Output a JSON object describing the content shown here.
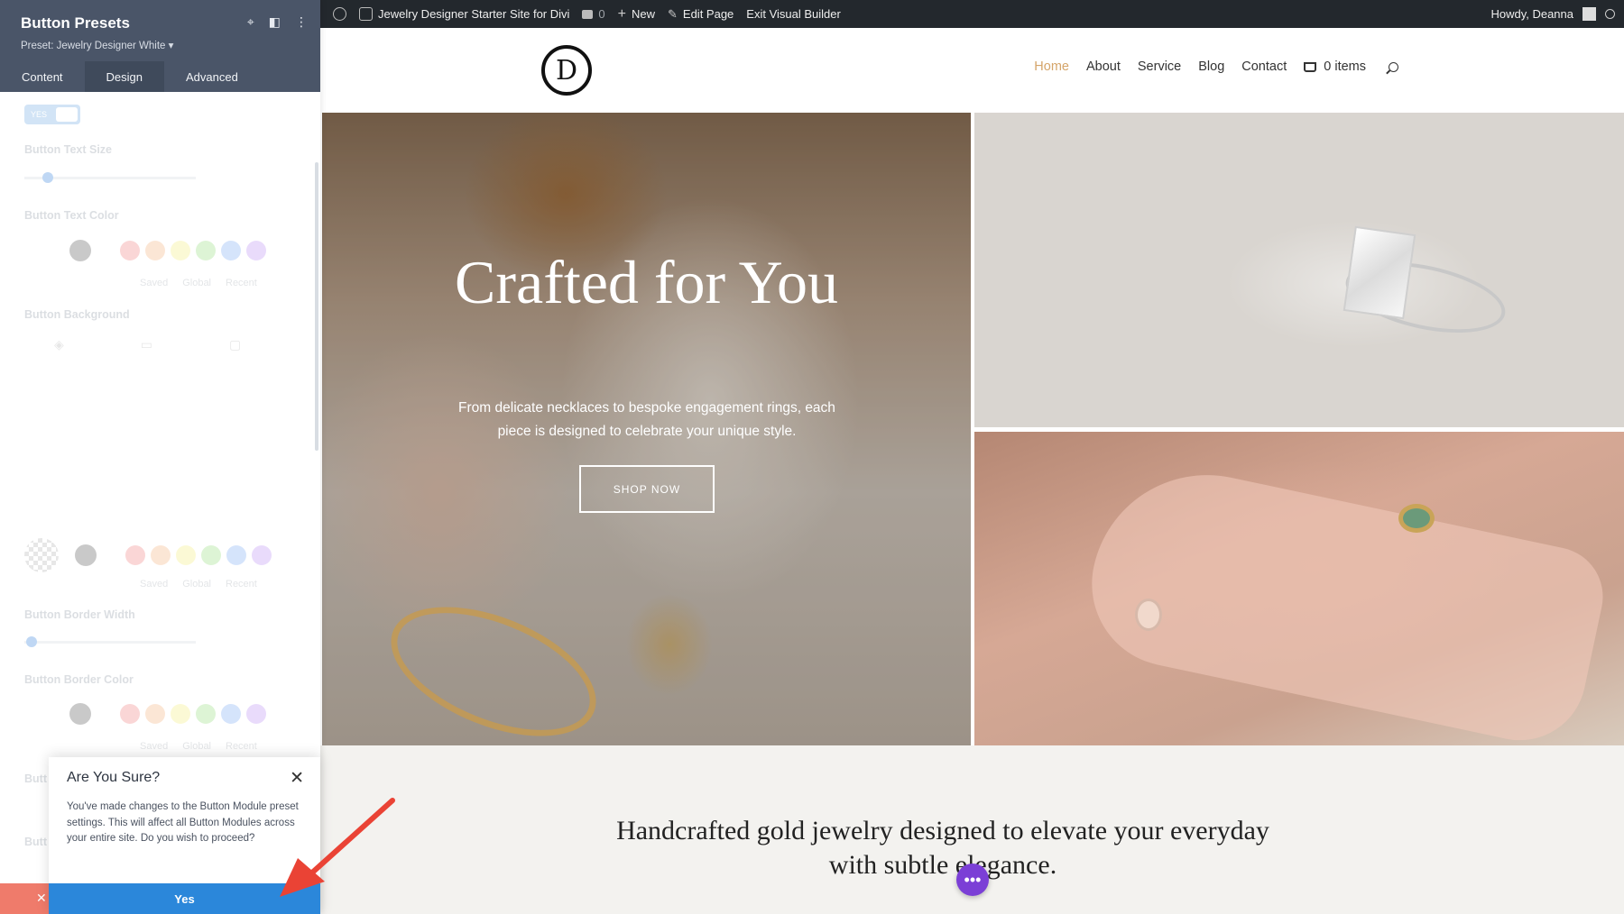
{
  "adminbar": {
    "site_name": "Jewelry Designer Starter Site for Divi",
    "comments_count": "0",
    "new_label": "New",
    "edit_label": "Edit Page",
    "exit_label": "Exit Visual Builder",
    "howdy": "Howdy, Deanna"
  },
  "panel": {
    "title": "Button Presets",
    "preset": "Preset: Jewelry Designer White ▾",
    "tabs": [
      "Content",
      "Design",
      "Advanced"
    ],
    "active_tab": "Design",
    "toggle_label": "YES",
    "fields": {
      "text_size": "Button Text Size",
      "text_color": "Button Text Color",
      "background": "Button Background",
      "border_width": "Button Border Width",
      "border_color": "Button Border Color",
      "truncated_a": "Butt",
      "truncated_b": "Butt"
    },
    "swatch_meta": [
      "Saved",
      "Global",
      "Recent"
    ],
    "swatch_colors": [
      "#f28b8b",
      "#f6b98a",
      "#f5f08a",
      "#9fe08a",
      "#8ab3f6",
      "#c19af6"
    ],
    "icons": [
      "focus-icon",
      "layout-icon",
      "more-vertical-icon"
    ]
  },
  "dialog": {
    "title": "Are You Sure?",
    "body": "You've made changes to the Button Module preset settings. This will affect all Button Modules across your entire site. Do you wish to proceed?",
    "yes_label": "Yes"
  },
  "site": {
    "logo_letter": "D",
    "nav": [
      "Home",
      "About",
      "Service",
      "Blog",
      "Contact"
    ],
    "active_nav": "Home",
    "cart_label": "0 items",
    "accent": "#d5a56a"
  },
  "hero": {
    "title": "Crafted for You",
    "subtitle": "From delicate necklaces to bespoke engagement rings, each piece is designed to celebrate your unique style.",
    "cta": "SHOP NOW"
  },
  "lower": {
    "tagline": "Handcrafted gold jewelry designed to elevate your everyday with subtle elegance."
  },
  "floating": {
    "dots": "•••",
    "color": "#7b3fd6"
  }
}
